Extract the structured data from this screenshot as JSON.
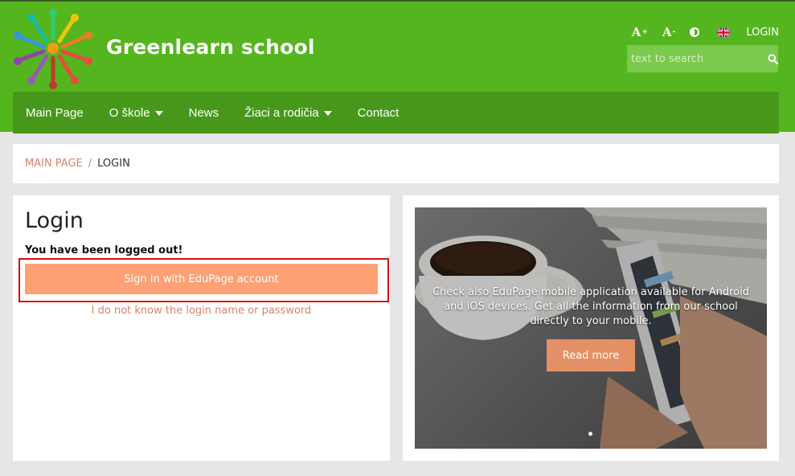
{
  "header": {
    "site_title": "Greenlearn school",
    "tools": {
      "font_increase": "A",
      "font_increase_sup": "+",
      "font_decrease": "A",
      "font_decrease_sup": "-",
      "contrast_icon": "contrast-icon",
      "language_flag": "uk-flag-icon",
      "login": "LOGIN"
    },
    "search": {
      "placeholder": "text to search",
      "icon": "search-icon"
    }
  },
  "nav": {
    "items": [
      {
        "label": "Main Page",
        "has_dropdown": false
      },
      {
        "label": "O škole",
        "has_dropdown": true
      },
      {
        "label": "News",
        "has_dropdown": false
      },
      {
        "label": "Žiaci a rodičia",
        "has_dropdown": true
      },
      {
        "label": "Contact",
        "has_dropdown": false
      }
    ]
  },
  "breadcrumb": {
    "home": "MAIN PAGE",
    "separator": "/",
    "current": "LOGIN"
  },
  "login": {
    "title": "Login",
    "message": "You have been logged out!",
    "signin_button": "Sign in with EduPage account",
    "forgot_link": "I do not know the login name or password"
  },
  "promo": {
    "text": "Check also EduPage mobile application available for Android and iOS devices. Get all the information from our school directly to your mobile.",
    "read_more": "Read more"
  },
  "colors": {
    "header_green": "#55b51f",
    "nav_green": "#47981a",
    "accent_orange": "#fda074",
    "link_orange": "#d9846a",
    "highlight_red": "#d9100f"
  }
}
